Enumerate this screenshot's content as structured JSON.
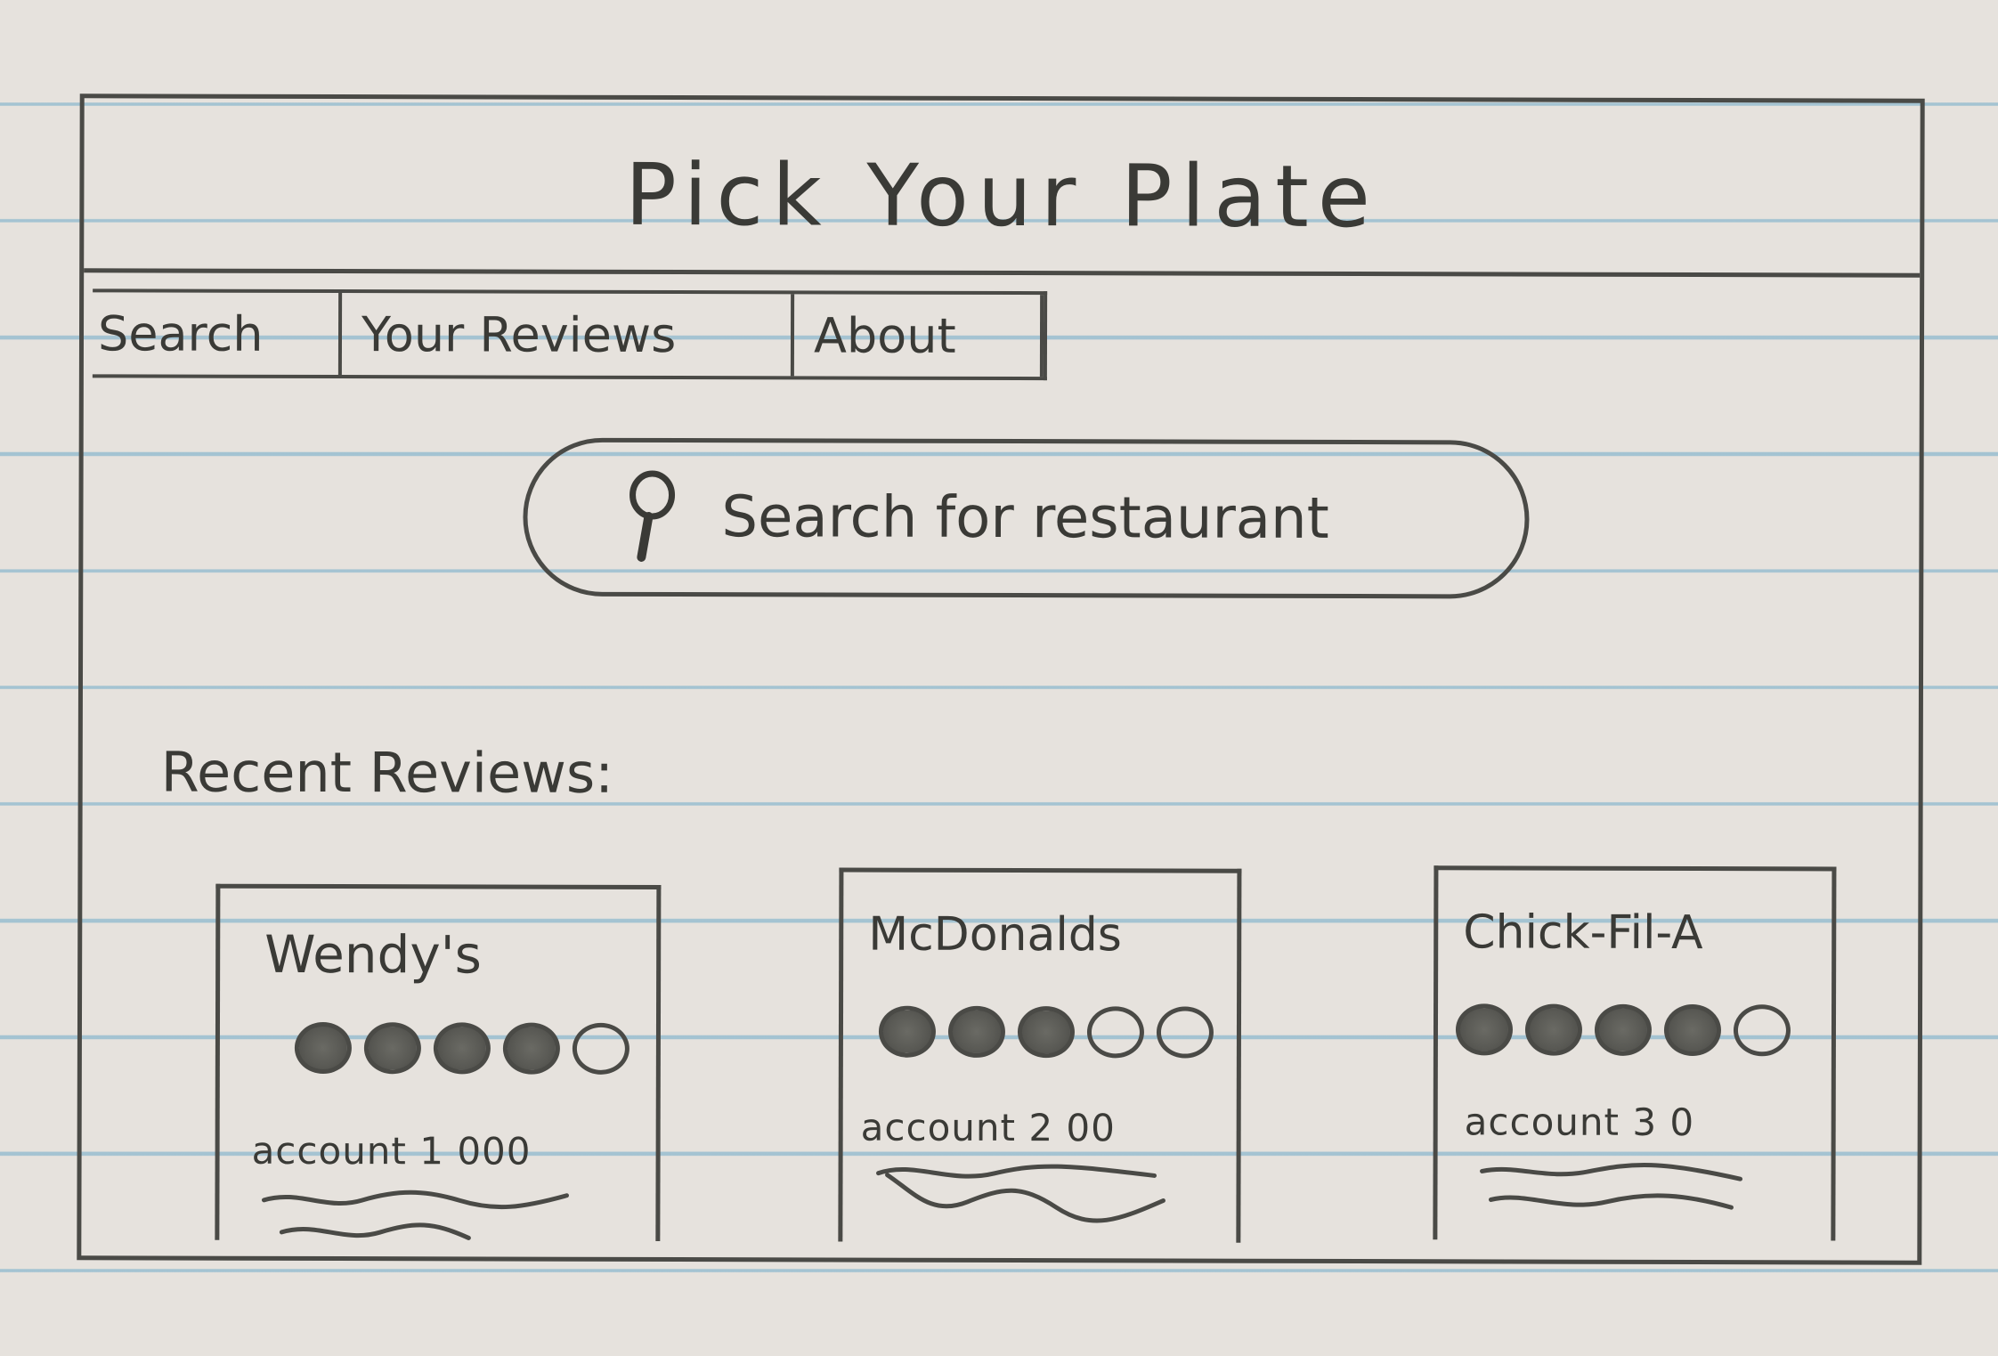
{
  "app": {
    "title": "Pick Your Plate"
  },
  "nav": {
    "tabs": [
      {
        "label": "Search"
      },
      {
        "label": "Your Reviews"
      },
      {
        "label": "About"
      }
    ]
  },
  "search": {
    "icon": "search-icon",
    "placeholder": "Search for restaurant"
  },
  "recent_reviews": {
    "heading": "Recent Reviews:",
    "cards": [
      {
        "restaurant": "Wendy's",
        "rating": 4,
        "max_rating": 5,
        "reviewer": "account 1",
        "extra": "000"
      },
      {
        "restaurant": "McDonalds",
        "rating": 3,
        "max_rating": 5,
        "reviewer": "account 2",
        "extra": "00"
      },
      {
        "restaurant": "Chick-Fil-A",
        "rating": 4,
        "max_rating": 5,
        "reviewer": "account 3",
        "extra": "0"
      }
    ]
  },
  "colors": {
    "ink": "#4a4a46",
    "paper": "#e6e2dd",
    "rule_line": "#6eaac8"
  }
}
